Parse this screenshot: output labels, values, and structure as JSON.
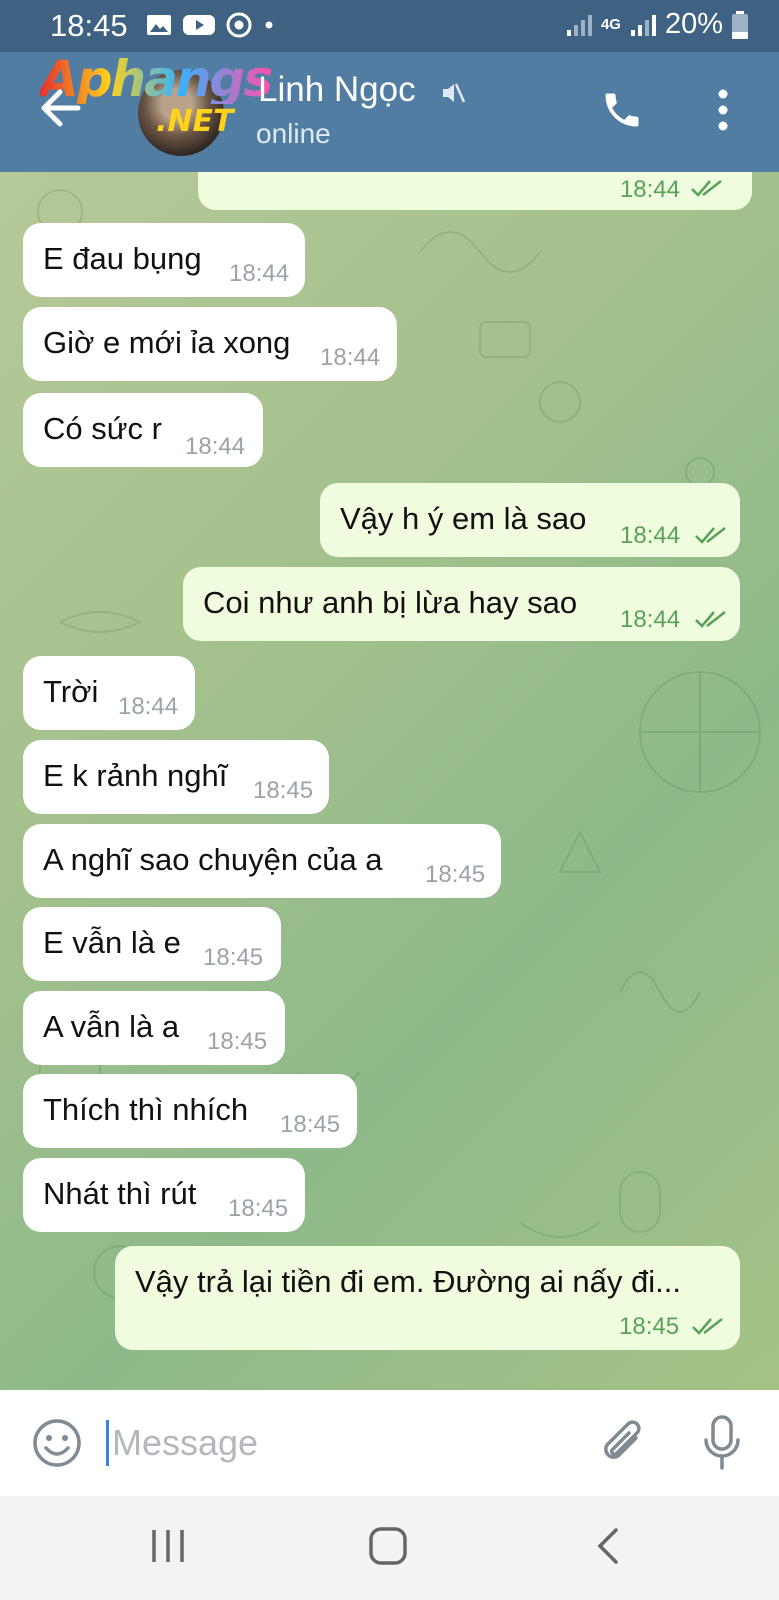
{
  "status_bar": {
    "time": "18:45",
    "network": "4G",
    "battery": "20%"
  },
  "header": {
    "contact_name": "Linh Ngọc",
    "contact_status": "online",
    "watermark_line1": "Aphangs",
    "watermark_line2": ".NET"
  },
  "messages": [
    {
      "text": "",
      "time": "18:44",
      "dir": "out"
    },
    {
      "text": "E đau bụng",
      "time": "18:44",
      "dir": "in"
    },
    {
      "text": "Giờ e mới ỉa xong",
      "time": "18:44",
      "dir": "in"
    },
    {
      "text": "Có sức r",
      "time": "18:44",
      "dir": "in"
    },
    {
      "text": "Vậy h ý em là sao",
      "time": "18:44",
      "dir": "out"
    },
    {
      "text": "Coi như anh bị lừa hay sao",
      "time": "18:44",
      "dir": "out"
    },
    {
      "text": "Trời",
      "time": "18:44",
      "dir": "in"
    },
    {
      "text": "E k rảnh nghĩ",
      "time": "18:45",
      "dir": "in"
    },
    {
      "text": "A nghĩ sao chuyện của a",
      "time": "18:45",
      "dir": "in"
    },
    {
      "text": "E vẫn là e",
      "time": "18:45",
      "dir": "in"
    },
    {
      "text": "A vẫn là a",
      "time": "18:45",
      "dir": "in"
    },
    {
      "text": "Thích thì nhích",
      "time": "18:45",
      "dir": "in"
    },
    {
      "text": "Nhát thì rút",
      "time": "18:45",
      "dir": "in"
    },
    {
      "text": "Vậy trả lại tiền đi em. Đường ai nấy đi...",
      "time": "18:45",
      "dir": "out"
    }
  ],
  "input": {
    "placeholder": "Message"
  },
  "colors": {
    "header": "#527da3",
    "status_bar": "#3f6283",
    "outgoing_bubble": "#effdde",
    "incoming_bubble": "#ffffff",
    "tick": "#5aa05a"
  },
  "icons": [
    "back-arrow-icon",
    "mute-icon",
    "phone-icon",
    "more-vert-icon",
    "emoji-icon",
    "attach-icon",
    "mic-icon"
  ]
}
